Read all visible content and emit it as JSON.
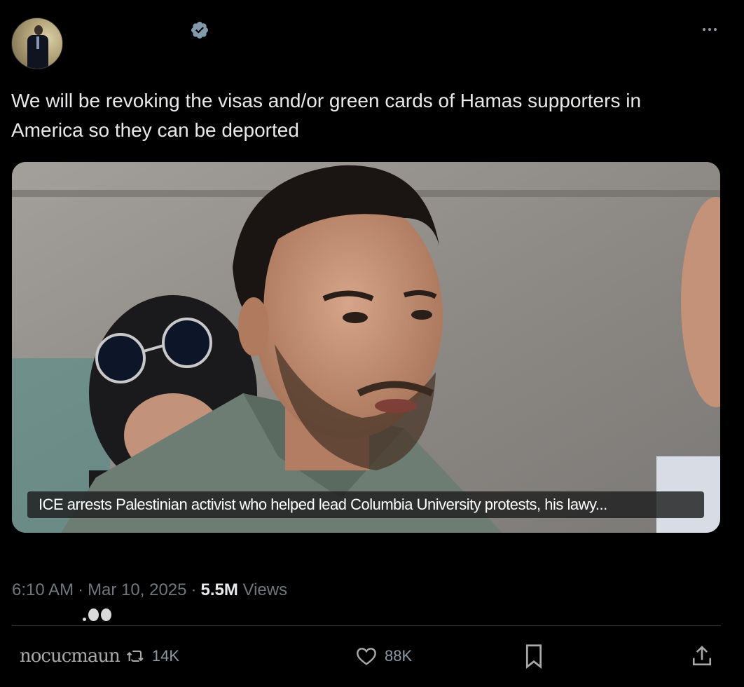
{
  "tweet": {
    "text": "We will be revoking the visas and/or green cards of Hamas supporters in\nAmerica so they can be deported"
  },
  "media": {
    "caption": "ICE arrests Palestinian activist who helped lead Columbia University protests, his lawy..."
  },
  "meta": {
    "time": "6:10 AM",
    "separator": "·",
    "date": "Mar 10, 2025",
    "views_count": "5.5M",
    "views_label": "Views"
  },
  "actions": {
    "retweet_garbled_text": "nocucmaun",
    "retweet_count": "14K",
    "like_count": "88K"
  },
  "icons": {
    "verified": "verified-badge-icon",
    "more": "more-options-icon",
    "retweet": "retweet-icon",
    "like": "heart-icon",
    "bookmark": "bookmark-icon",
    "share": "share-icon"
  },
  "colors": {
    "background": "#000000",
    "text_primary": "#e7e9ea",
    "text_secondary": "#71767b",
    "divider": "#2f3336",
    "caption_background": "#1e1e1e"
  }
}
